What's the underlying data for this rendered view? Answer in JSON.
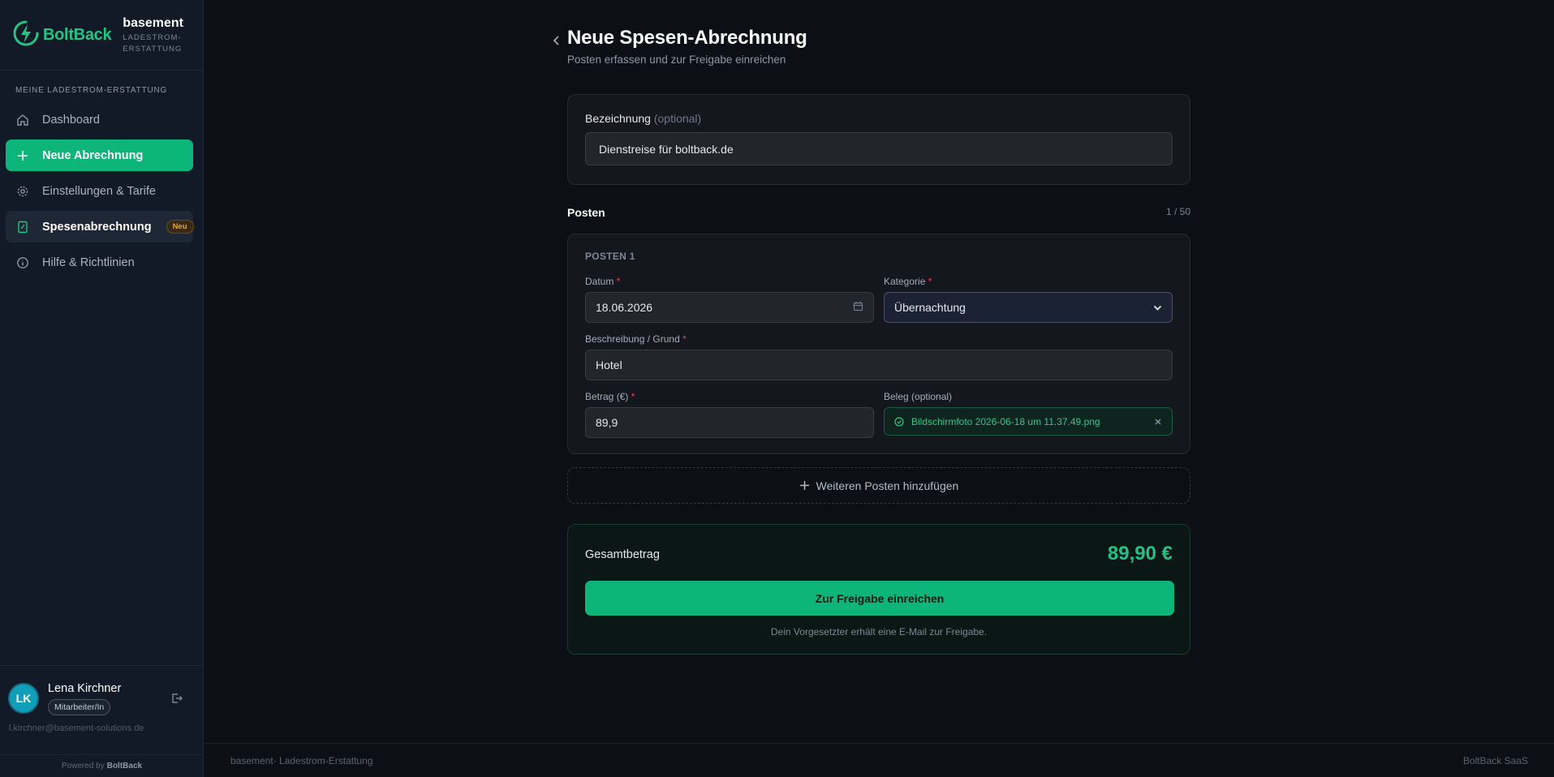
{
  "brand": {
    "logo_text": "BoltBack",
    "org_name": "basement",
    "org_sub": "LADESTROM-ERSTATTUNG"
  },
  "sidebar": {
    "section_label": "MEINE LADESTROM-ERSTATTUNG",
    "items": [
      {
        "label": "Dashboard",
        "icon": "home-icon"
      },
      {
        "label": "Neue Abrechnung",
        "icon": "plus-icon"
      },
      {
        "label": "Einstellungen & Tarife",
        "icon": "gear-icon"
      },
      {
        "label": "Spesenabrechnung",
        "icon": "receipt-icon",
        "badge": "Neu"
      },
      {
        "label": "Hilfe & Richtlinien",
        "icon": "info-icon"
      }
    ]
  },
  "user": {
    "initials": "LK",
    "name": "Lena Kirchner",
    "role": "Mitarbeiter/In",
    "email": "l.kirchner@basement-solutions.de"
  },
  "powered": {
    "prefix": "Powered by",
    "brand": "BoltBack"
  },
  "page": {
    "title": "Neue Spesen-Abrechnung",
    "subtitle": "Posten erfassen und zur Freigabe einreichen"
  },
  "bezeichnung": {
    "label": "Bezeichnung",
    "optional": "(optional)",
    "value": "Dienstreise für boltback.de"
  },
  "posts": {
    "title": "Posten",
    "count": "1 / 50",
    "items": [
      {
        "heading": "POSTEN 1",
        "date_label": "Datum",
        "date_value": "18.06.2026",
        "category_label": "Kategorie",
        "category_value": "Übernachtung",
        "desc_label": "Beschreibung / Grund",
        "desc_value": "Hotel",
        "amount_label": "Betrag (€)",
        "amount_value": "89,9",
        "receipt_label": "Beleg (optional)",
        "receipt_file": "Bildschirmfoto 2026-06-18 um 11.37.49.png"
      }
    ],
    "add_label": "Weiteren Posten hinzufügen"
  },
  "summary": {
    "label": "Gesamtbetrag",
    "value": "89,90 €",
    "submit_label": "Zur Freigabe einreichen",
    "note": "Dein Vorgesetzter erhält eine E-Mail zur Freigabe."
  },
  "footer": {
    "left": "basement· Ladestrom-Erstattung",
    "right": "BoltBack SaaS"
  },
  "colors": {
    "accent": "#0db57a",
    "accent_text": "#21c287",
    "badge": "#e4a53a",
    "required": "#f04444"
  }
}
